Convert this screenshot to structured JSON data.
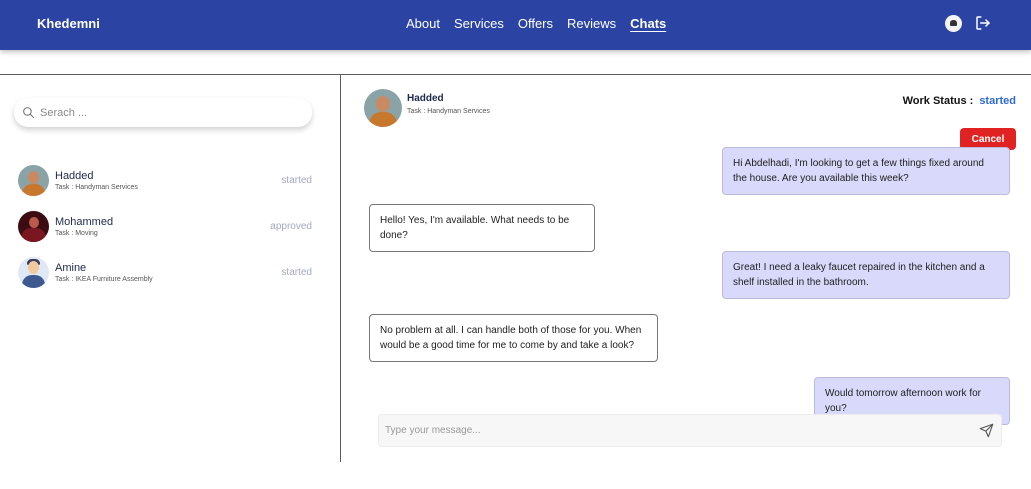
{
  "app": {
    "brand": "Khedemni"
  },
  "nav": {
    "items": [
      {
        "label": "About"
      },
      {
        "label": "Services"
      },
      {
        "label": "Offers"
      },
      {
        "label": "Reviews"
      },
      {
        "label": "Chats",
        "active": true
      }
    ],
    "icons": [
      "profile-avatar-icon",
      "logout-icon"
    ]
  },
  "sidebar": {
    "search_placeholder": "Serach ...",
    "conversations": [
      {
        "name": "Hadded",
        "task": "Task : Handyman Services",
        "status": "started"
      },
      {
        "name": "Mohammed",
        "task": "Task : Moving",
        "status": "approved"
      },
      {
        "name": "Amine",
        "task": "Task : IKEA Furniture Assembly",
        "status": "started"
      }
    ]
  },
  "chat": {
    "name": "Hadded",
    "task": "Task : Handyman Services",
    "work_status_label": "Work Status :",
    "work_status_value": "started",
    "cancel_label": "Cancel",
    "messages": [
      {
        "side": "out",
        "text": "Hi Abdelhadi, I'm looking to get a few things fixed around the house. Are you available this week?"
      },
      {
        "side": "in",
        "text": "Hello! Yes, I'm available. What needs to be done?"
      },
      {
        "side": "out",
        "text": "Great! I need a leaky faucet repaired in the kitchen and a shelf installed in the bathroom."
      },
      {
        "side": "in",
        "text": "No problem at all. I can handle both of those for you. When would be a good time for me to come by and take a look?"
      },
      {
        "side": "out",
        "text": "Would tomorrow afternoon work for you?"
      }
    ],
    "input_placeholder": "Type your message..."
  },
  "colors": {
    "nav_bg": "#2b44a4",
    "accent": "#2e6ad4",
    "cancel": "#e12222",
    "outgoing_bubble": "#d9d9fb"
  }
}
